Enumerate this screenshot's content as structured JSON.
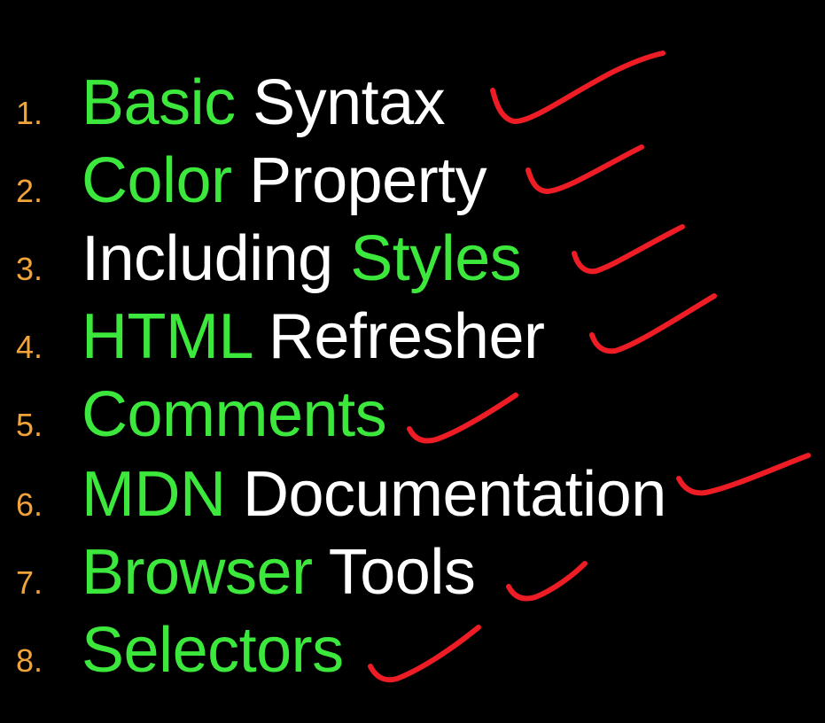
{
  "colors": {
    "background": "#000000",
    "number": "#f2a33a",
    "green": "#3ce83c",
    "white": "#ffffff",
    "check": "#ee1c25"
  },
  "items": [
    {
      "number": "1.",
      "parts": [
        {
          "text": "Basic",
          "color": "green"
        },
        {
          "text": " Syntax",
          "color": "white"
        }
      ]
    },
    {
      "number": "2.",
      "parts": [
        {
          "text": "Color",
          "color": "green"
        },
        {
          "text": " Property",
          "color": "white"
        }
      ]
    },
    {
      "number": "3.",
      "parts": [
        {
          "text": "Including",
          "color": "white"
        },
        {
          "text": " Styles",
          "color": "green"
        }
      ]
    },
    {
      "number": "4.",
      "parts": [
        {
          "text": "HTML",
          "color": "green"
        },
        {
          "text": " Refresher",
          "color": "white"
        }
      ]
    },
    {
      "number": "5.",
      "parts": [
        {
          "text": "Comments",
          "color": "green"
        }
      ]
    },
    {
      "number": "6.",
      "parts": [
        {
          "text": "MDN",
          "color": "green"
        },
        {
          "text": " Documentation",
          "color": "white"
        }
      ]
    },
    {
      "number": "7.",
      "parts": [
        {
          "text": "Browser",
          "color": "green"
        },
        {
          "text": " Tools",
          "color": "white"
        }
      ]
    },
    {
      "number": "8.",
      "parts": [
        {
          "text": "Selectors",
          "color": "green"
        }
      ]
    }
  ],
  "checkmarks": {
    "icon": "handwritten-checkmark-icon",
    "count": 8
  }
}
